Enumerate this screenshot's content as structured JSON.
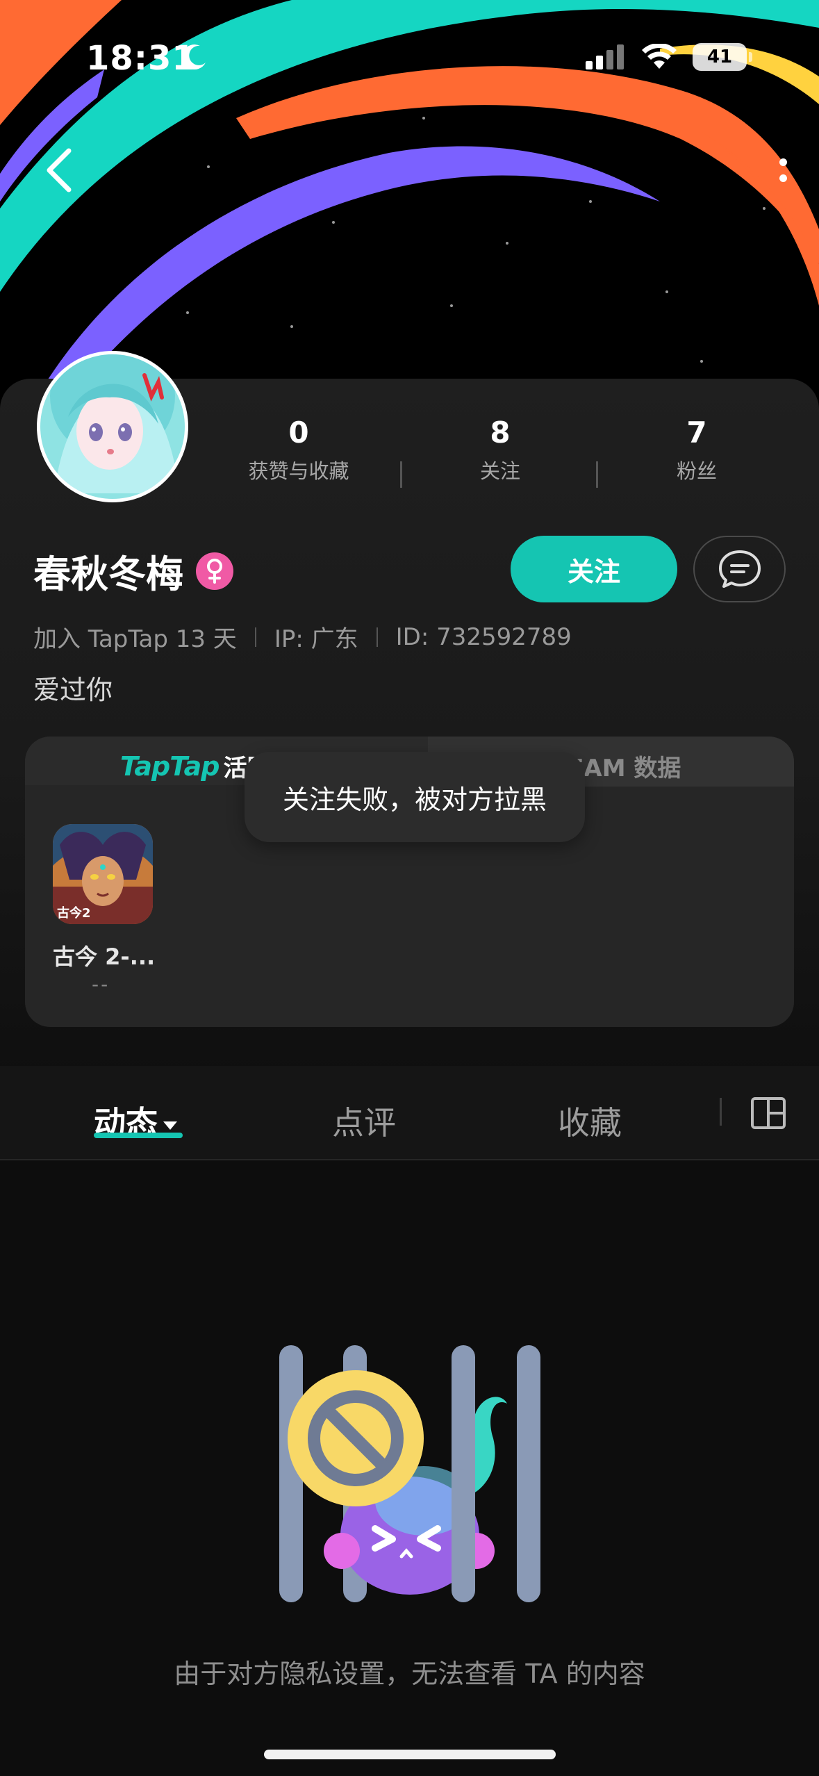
{
  "status_bar": {
    "time": "18:31",
    "battery": "41"
  },
  "nav": {
    "back_icon": "chevron-left-icon",
    "more_icon": "more-vertical-icon"
  },
  "profile": {
    "stats": [
      {
        "value": "0",
        "label": "获赞与收藏"
      },
      {
        "value": "8",
        "label": "关注"
      },
      {
        "value": "7",
        "label": "粉丝"
      }
    ],
    "name": "春秋冬梅",
    "gender_icon": "female-icon",
    "follow_label": "关注",
    "message_icon": "message-icon",
    "meta": {
      "joined": "加入 TapTap 13 天",
      "ip": "IP: 广东",
      "id": "ID: 732592789"
    },
    "bio": "爱过你"
  },
  "games_card": {
    "tab_taptap_logo": "TapTap",
    "tab_taptap_text": "活跃",
    "tab_team": "TEAM 数据",
    "game": {
      "name": "古今 2-...",
      "score": "--",
      "icon_caption": "古今2"
    }
  },
  "toast": {
    "message": "关注失败，被对方拉黑"
  },
  "content_tabs": {
    "tabs": [
      "动态",
      "点评",
      "收藏"
    ],
    "active_index": 0
  },
  "empty_state": {
    "message": "由于对方隐私设置，无法查看 TA 的内容"
  },
  "colors": {
    "accent": "#15c5b2",
    "gender": "#f05aa5",
    "background": "#0d0d0d"
  }
}
